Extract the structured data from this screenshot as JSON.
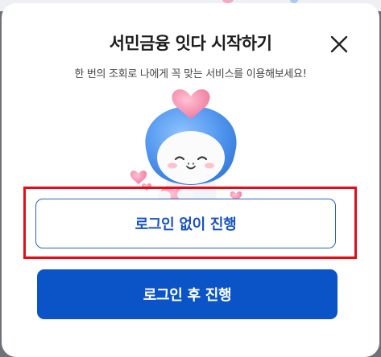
{
  "modal": {
    "title": "서민금융 잇다 시작하기",
    "subtitle": "한 번의 조회로 나에게 꼭 맞는 서비스를 이용해보세요!"
  },
  "icons": {
    "close": "close-icon",
    "mascot": "mascot-illustration"
  },
  "buttons": {
    "no_login_label": "로그인 없이 진행",
    "login_label": "로그인 후 진행"
  },
  "colors": {
    "primary": "#0b54c7",
    "outline": "#2563c9",
    "highlight": "#e10f14"
  }
}
